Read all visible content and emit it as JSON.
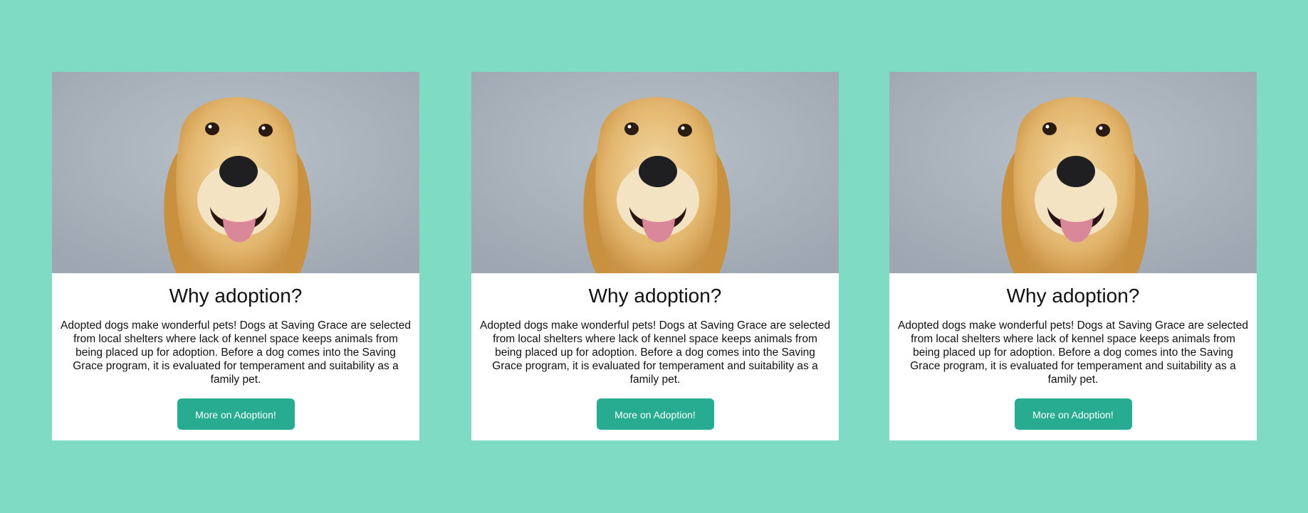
{
  "colors": {
    "page_background": "#7fdbc4",
    "card_background": "#ffffff",
    "button_background": "#27ab91",
    "button_text": "#ffffff",
    "photo_background": "#a9b2bc",
    "dog_fur": "#e2b56c"
  },
  "cards": [
    {
      "image_icon": "golden-retriever-photo",
      "title": "Why adoption?",
      "body": "Adopted dogs make wonderful pets! Dogs at Saving Grace are selected from local shelters where lack of kennel space keeps animals from being placed up for adoption. Before a dog comes into the Saving Grace program, it is evaluated for temperament and suitability as a family pet.",
      "button_label": "More on Adoption!"
    },
    {
      "image_icon": "golden-retriever-photo",
      "title": "Why adoption?",
      "body": "Adopted dogs make wonderful pets! Dogs at Saving Grace are selected from local shelters where lack of kennel space keeps animals from being placed up for adoption. Before a dog comes into the Saving Grace program, it is evaluated for temperament and suitability as a family pet.",
      "button_label": "More on Adoption!"
    },
    {
      "image_icon": "golden-retriever-photo",
      "title": "Why adoption?",
      "body": "Adopted dogs make wonderful pets! Dogs at Saving Grace are selected from local shelters where lack of kennel space keeps animals from being placed up for adoption. Before a dog comes into the Saving Grace program, it is evaluated for temperament and suitability as a family pet.",
      "button_label": "More on Adoption!"
    }
  ]
}
